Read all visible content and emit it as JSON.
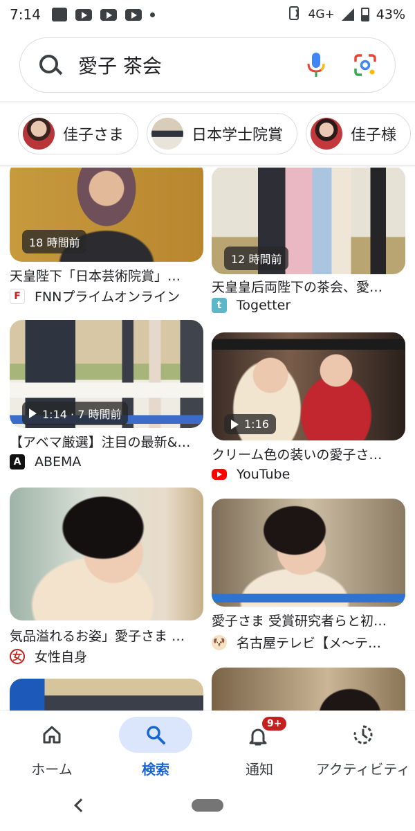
{
  "status_bar": {
    "time": "7:14",
    "network": "4G+",
    "battery": "43%"
  },
  "search": {
    "query": "愛子 茶会"
  },
  "chips": [
    {
      "label": "佳子さま"
    },
    {
      "label": "日本学士院賞"
    },
    {
      "label": "佳子様"
    }
  ],
  "results": [
    {
      "badge": "18 時間前",
      "has_play": false,
      "title": "天皇陛下「日本芸術院賞」…",
      "source": "FNNプライムオンライン",
      "icon": "fnn-logo-icon"
    },
    {
      "badge": "12 時間前",
      "has_play": false,
      "title": "天皇皇后両陛下の茶会、愛…",
      "source": "Togetter",
      "icon": "togetter-logo-icon"
    },
    {
      "badge": "1:14 · 7 時間前",
      "has_play": true,
      "title": "【アベマ厳選】注目の最新&…",
      "source": "ABEMA",
      "icon": "abema-logo-icon"
    },
    {
      "badge": "1:16",
      "has_play": true,
      "title": "クリーム色の装いの愛子さ…",
      "source": "YouTube",
      "icon": "youtube-logo-icon"
    },
    {
      "badge": "",
      "has_play": false,
      "title": "気品溢れるお姿」愛子さま …",
      "source": "女性自身",
      "icon": "josei-jishin-logo-icon"
    },
    {
      "badge": "",
      "has_play": false,
      "title": "愛子さま 受賞研究者らと初…",
      "source": "名古屋テレビ【メ～テ…",
      "icon": "nagoya-tv-logo-icon"
    }
  ],
  "bottom_nav": {
    "home": "ホーム",
    "search": "検索",
    "notifications": "通知",
    "notifications_badge": "9+",
    "activity": "アクティビティ"
  },
  "colors": {
    "accent": "#1a66d0",
    "active_pill": "#dbe6fc",
    "badge_red": "#c5221f"
  }
}
